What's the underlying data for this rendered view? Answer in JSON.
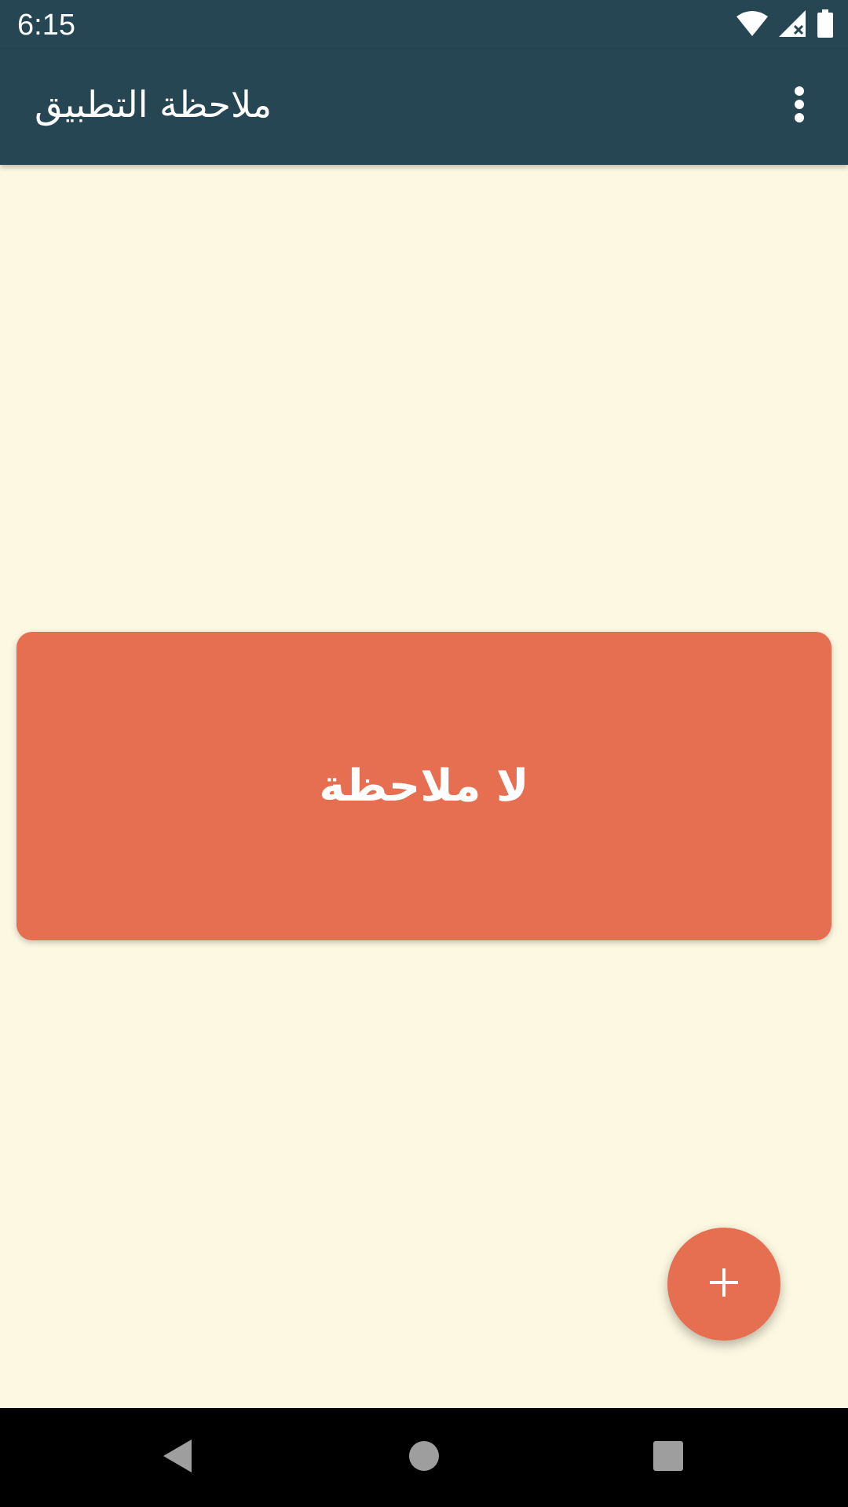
{
  "status_bar": {
    "time": "6:15",
    "icons": [
      "wifi-icon",
      "signal-icon",
      "battery-icon"
    ],
    "background": "#264653"
  },
  "app_bar": {
    "title": "ملاحظة التطبيق",
    "overflow_icon": "more-vert-icon",
    "background": "#264653"
  },
  "content": {
    "empty_message": "لا ملاحظة",
    "background": "#FDF8E1",
    "card_color": "#E76F51"
  },
  "fab": {
    "icon": "plus-icon",
    "color": "#E76F51"
  },
  "nav_bar": {
    "buttons": [
      "back-icon",
      "home-icon",
      "recents-icon"
    ]
  }
}
